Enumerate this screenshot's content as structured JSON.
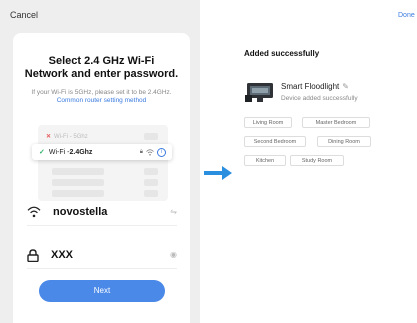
{
  "left": {
    "cancel": "Cancel",
    "title_line1": "Select 2.4 GHz Wi-Fi",
    "title_line2": "Network and enter password.",
    "hint_text": "If your Wi-Fi is 5GHz, please set it to be 2.4GHz.",
    "hint_link": "Common router setting method",
    "illus_5g": "Wi-Fi - 5Ghz",
    "illus_24_prefix": "Wi-Fi - ",
    "illus_24_name": "2.4Ghz",
    "ssid": "novostella",
    "password": "XXX",
    "next": "Next"
  },
  "right": {
    "done": "Done",
    "added_title": "Added successfully",
    "device_name": "Smart Floodlight",
    "device_status": "Device added successfully",
    "rooms": [
      "Living Room",
      "Master Bedroom",
      "Second Bedroom",
      "Dining Room",
      "Kitchen",
      "Study Room"
    ]
  },
  "icons": {
    "wifi": "wifi-icon",
    "lock": "lock-icon",
    "eye": "eye-icon",
    "swap": "swap-icon",
    "edit": "pencil-icon",
    "arrow": "right-arrow-icon"
  },
  "colors": {
    "accent": "#4a89e8",
    "link": "#3a7be0",
    "check": "#31b36b",
    "arrow": "#2b8fe0"
  }
}
